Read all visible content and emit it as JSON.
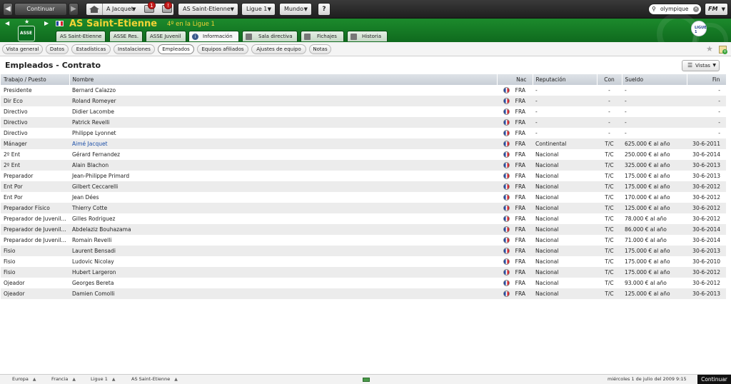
{
  "topbar": {
    "continue_label": "Continuar",
    "manager_label": "A Jacquet",
    "inbox_badge": "1",
    "news_badge": "!",
    "club_menu": "AS Saint-Etienne",
    "league_menu": "Ligue 1",
    "world_menu": "Mundo",
    "search_value": "olympique",
    "fm_label": "FM"
  },
  "header": {
    "club_name": "AS Saint-Etienne",
    "position_text": "4º en la Ligue 1",
    "crest_text": "ASSE",
    "league_logo_text": "LIGUE 1",
    "tabs": [
      {
        "label": "AS Saint-Etienne"
      },
      {
        "label": "ASSE Res."
      },
      {
        "label": "ASSE Juvenil"
      },
      {
        "label": "Información"
      },
      {
        "label": "Sala directiva"
      },
      {
        "label": "Fichajes"
      },
      {
        "label": "Historia"
      }
    ]
  },
  "subnav": {
    "items": [
      {
        "label": "Vista general"
      },
      {
        "label": "Datos"
      },
      {
        "label": "Estadísticas"
      },
      {
        "label": "Instalaciones"
      },
      {
        "label": "Empleados"
      },
      {
        "label": "Equipos afiliados"
      },
      {
        "label": "Ajustes de equipo"
      },
      {
        "label": "Notas"
      }
    ],
    "active": "Empleados"
  },
  "page": {
    "title": "Empleados - Contrato",
    "vistas_label": "Vistas"
  },
  "table": {
    "columns": [
      "Trabajo / Puesto",
      "Nombre",
      "Nac",
      "Reputación",
      "Con",
      "Sueldo",
      "Fin"
    ],
    "rows": [
      {
        "job": "Presidente",
        "name": "Bernard Caïazzo",
        "nat": "FRA",
        "rep": "-",
        "con": "-",
        "wage": "-",
        "end": "-"
      },
      {
        "job": "Dir Eco",
        "name": "Roland Romeyer",
        "nat": "FRA",
        "rep": "-",
        "con": "-",
        "wage": "-",
        "end": "-"
      },
      {
        "job": "Directivo",
        "name": "Didier Lacombe",
        "nat": "FRA",
        "rep": "-",
        "con": "-",
        "wage": "-",
        "end": "-"
      },
      {
        "job": "Directivo",
        "name": "Patrick Revelli",
        "nat": "FRA",
        "rep": "-",
        "con": "-",
        "wage": "-",
        "end": "-"
      },
      {
        "job": "Directivo",
        "name": "Philippe Lyonnet",
        "nat": "FRA",
        "rep": "-",
        "con": "-",
        "wage": "-",
        "end": "-"
      },
      {
        "job": "Mánager",
        "name": "Aimé Jacquet",
        "nat": "FRA",
        "rep": "Continental",
        "con": "T/C",
        "wage": "625.000 € al año",
        "end": "30-6-2011",
        "link": true
      },
      {
        "job": "2º Ent",
        "name": "Gérard Fernandez",
        "nat": "FRA",
        "rep": "Nacional",
        "con": "T/C",
        "wage": "250.000 € al año",
        "end": "30-6-2014"
      },
      {
        "job": "2º Ent",
        "name": "Alain Blachon",
        "nat": "FRA",
        "rep": "Nacional",
        "con": "T/C",
        "wage": "325.000 € al año",
        "end": "30-6-2013"
      },
      {
        "job": "Preparador",
        "name": "Jean-Philippe Primard",
        "nat": "FRA",
        "rep": "Nacional",
        "con": "T/C",
        "wage": "175.000 € al año",
        "end": "30-6-2013"
      },
      {
        "job": "Ent Por",
        "name": "Gilbert Ceccarelli",
        "nat": "FRA",
        "rep": "Nacional",
        "con": "T/C",
        "wage": "175.000 € al año",
        "end": "30-6-2012"
      },
      {
        "job": "Ent Por",
        "name": "Jean Dées",
        "nat": "FRA",
        "rep": "Nacional",
        "con": "T/C",
        "wage": "170.000 € al año",
        "end": "30-6-2012"
      },
      {
        "job": "Preparador Físico",
        "name": "Thierry Cotte",
        "nat": "FRA",
        "rep": "Nacional",
        "con": "T/C",
        "wage": "125.000 € al año",
        "end": "30-6-2012"
      },
      {
        "job": "Preparador de Juvenil...",
        "name": "Gilles Rodriguez",
        "nat": "FRA",
        "rep": "Nacional",
        "con": "T/C",
        "wage": "78.000 € al año",
        "end": "30-6-2012"
      },
      {
        "job": "Preparador de Juvenil...",
        "name": "Abdelaziz Bouhazama",
        "nat": "FRA",
        "rep": "Nacional",
        "con": "T/C",
        "wage": "86.000 € al año",
        "end": "30-6-2014"
      },
      {
        "job": "Preparador de Juvenil...",
        "name": "Romain Revelli",
        "nat": "FRA",
        "rep": "Nacional",
        "con": "T/C",
        "wage": "71.000 € al año",
        "end": "30-6-2014"
      },
      {
        "job": "Fisio",
        "name": "Laurent Bensadi",
        "nat": "FRA",
        "rep": "Nacional",
        "con": "T/C",
        "wage": "175.000 € al año",
        "end": "30-6-2013"
      },
      {
        "job": "Fisio",
        "name": "Ludovic Nicolay",
        "nat": "FRA",
        "rep": "Nacional",
        "con": "T/C",
        "wage": "175.000 € al año",
        "end": "30-6-2010"
      },
      {
        "job": "Fisio",
        "name": "Hubert Largeron",
        "nat": "FRA",
        "rep": "Nacional",
        "con": "T/C",
        "wage": "175.000 € al año",
        "end": "30-6-2012"
      },
      {
        "job": "Ojeador",
        "name": "Georges Bereta",
        "nat": "FRA",
        "rep": "Nacional",
        "con": "T/C",
        "wage": "93.000 € al año",
        "end": "30-6-2012"
      },
      {
        "job": "Ojeador",
        "name": "Damien Comolli",
        "nat": "FRA",
        "rep": "Nacional",
        "con": "T/C",
        "wage": "125.000 € al año",
        "end": "30-6-2013"
      }
    ]
  },
  "statusbar": {
    "crumbs": [
      "Europa",
      "Francia",
      "Ligue 1",
      "AS Saint-Etienne"
    ],
    "datetime": "miércoles 1 de julio del 2009 9:15",
    "continue_label": "Continuar"
  },
  "colors": {
    "header_green": "#1c8a2c",
    "club_name_yellow": "#f2d335",
    "link_blue": "#1c4fa8"
  }
}
